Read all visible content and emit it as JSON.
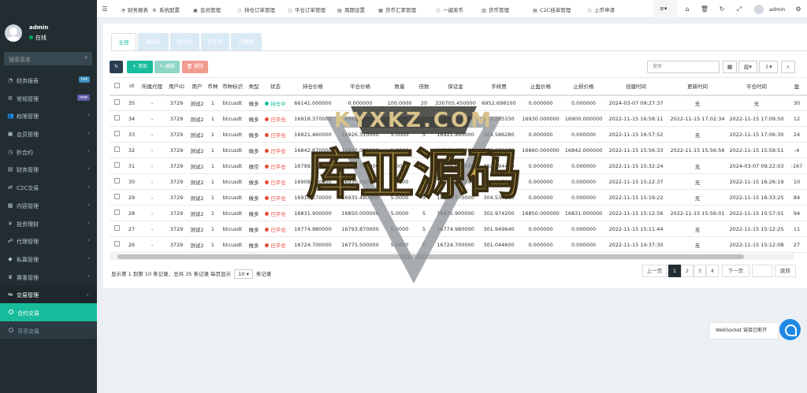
{
  "user": {
    "name": "admin",
    "status": "在线"
  },
  "sidebar": {
    "search_placeholder": "搜索菜单",
    "items": [
      {
        "label": "财务报表",
        "icon": "gauge-icon",
        "badge": "hot",
        "badge_color": "#3c8dbc"
      },
      {
        "label": "常规管理",
        "icon": "gear-icon",
        "badge": "new",
        "badge_color": "#605ca8"
      },
      {
        "label": "权限管理",
        "icon": "group-icon"
      },
      {
        "label": "会员管理",
        "icon": "user-icon"
      },
      {
        "label": "秒合约",
        "icon": "clock-icon"
      },
      {
        "label": "财务管理",
        "icon": "book-icon"
      },
      {
        "label": "C2C交易",
        "icon": "exchange-icon"
      },
      {
        "label": "内容管理",
        "icon": "file-icon"
      },
      {
        "label": "投资理财",
        "icon": "money-icon"
      },
      {
        "label": "代理管理",
        "icon": "agent-icon"
      },
      {
        "label": "私募管理",
        "icon": "diamond-icon"
      },
      {
        "label": "赛事管理",
        "icon": "trophy-icon"
      },
      {
        "label": "交易管理",
        "icon": "trade-icon"
      }
    ],
    "subitems": [
      {
        "label": "合约交易",
        "active": true
      },
      {
        "label": "币币交易",
        "active": false
      }
    ]
  },
  "topnav": {
    "items": [
      {
        "label": "财务报表"
      },
      {
        "label": "系统配置"
      },
      {
        "label": "会员管理"
      },
      {
        "label": "持仓订单管理"
      },
      {
        "label": "平仓订单管理"
      },
      {
        "label": "周期设置"
      },
      {
        "label": "货币汇率管理"
      },
      {
        "label": "一键发币"
      },
      {
        "label": "货币管理"
      },
      {
        "label": "C2C挂单管理"
      },
      {
        "label": "上币申请"
      }
    ],
    "user": "admin"
  },
  "tabs": [
    "全部",
    "待持仓",
    "持仓中",
    "已平仓",
    "已撤销"
  ],
  "toolbar": {
    "add": "添加",
    "edit": "编辑",
    "delete": "删除",
    "search_placeholder": "搜索"
  },
  "table": {
    "headers": [
      "id",
      "所属代理",
      "用户ID",
      "用户",
      "币种",
      "币种标识",
      "类型",
      "状态",
      "持仓价格",
      "平仓价格",
      "数量",
      "倍数",
      "保证金",
      "手续费",
      "止盈价格",
      "止损价格",
      "创建时间",
      "更新时间",
      "平仓时间"
    ],
    "rows": [
      [
        "35",
        "-",
        "3729",
        "测试2",
        "1",
        "btcusdt",
        "做多",
        "持仓中",
        "66141.000000",
        "0.000000",
        "100.0000",
        "20",
        "330705.450000",
        "6952.698100",
        "0.000000",
        "0.000000",
        "2024-03-07 09:27:37",
        "无",
        "无",
        "30"
      ],
      [
        "34",
        "-",
        "3729",
        "测试2",
        "1",
        "btcusdt",
        "做多",
        "已平仓",
        "16918.370000",
        "16943.470000",
        "5.0000",
        "5",
        "16918.370000",
        "152.265330",
        "16930.000000",
        "16900.000000",
        "2022-11-15 16:58:11",
        "2022-11-15 17:02:34",
        "2022-11-15 17:09:50",
        "12"
      ],
      [
        "33",
        "-",
        "3729",
        "测试2",
        "1",
        "btcusdt",
        "做多",
        "已平仓",
        "16921.460000",
        "16926.310000",
        "5.0000",
        "5",
        "16921.460000",
        "304.586280",
        "0.000000",
        "0.000000",
        "2022-11-15 16:57:52",
        "无",
        "2022-11-15 17:06:30",
        "24"
      ],
      [
        "32",
        "-",
        "3729",
        "测试2",
        "1",
        "btcusdt",
        "做多",
        "已平仓",
        "16842.870000",
        "16842.000000",
        "5.0000",
        "5",
        "16842.870000",
        "303.171660",
        "16860.000000",
        "16842.000000",
        "2022-11-15 15:56:33",
        "2022-11-15 15:56:56",
        "2022-11-15 15:58:51",
        "-4"
      ],
      [
        "31",
        "-",
        "3729",
        "测试2",
        "1",
        "btcusdt",
        "做空",
        "已平仓",
        "16799.690000",
        "66068.760000",
        "5.0000",
        "5",
        "16799.690000",
        "302.394420",
        "0.000000",
        "0.000000",
        "2022-11-15 15:32:24",
        "无",
        "2024-03-07 09:22:03",
        "-167"
      ],
      [
        "30",
        "-",
        "3729",
        "测试2",
        "1",
        "btcusdt",
        "做多",
        "已平仓",
        "16908.200000",
        "16930.000000",
        "5.0000",
        "5",
        "16908.200000",
        "304.347600",
        "0.000000",
        "0.000000",
        "2022-11-15 15:22:37",
        "无",
        "2022-11-15 16:26:19",
        "10"
      ],
      [
        "29",
        "-",
        "3729",
        "测试2",
        "1",
        "btcusdt",
        "做多",
        "已平仓",
        "16918.570000",
        "16935.480000",
        "5.0000",
        "5",
        "16918.570000",
        "304.534260",
        "0.000000",
        "0.000000",
        "2022-11-15 15:19:22",
        "无",
        "2022-11-15 16:33:25",
        "84"
      ],
      [
        "28",
        "-",
        "3729",
        "测试2",
        "1",
        "btcusdt",
        "做多",
        "已平仓",
        "16831.900000",
        "16850.000000",
        "5.0000",
        "5",
        "16831.900000",
        "302.974200",
        "16850.000000",
        "16831.000000",
        "2022-11-15 15:12:56",
        "2022-11-15 15:56:01",
        "2022-11-15 15:57:01",
        "94"
      ],
      [
        "27",
        "-",
        "3729",
        "测试2",
        "1",
        "btcusdt",
        "做多",
        "已平仓",
        "16774.980000",
        "16793.870000",
        "5.0000",
        "5",
        "16774.980000",
        "301.949640",
        "0.000000",
        "0.000000",
        "2022-11-15 15:11:44",
        "无",
        "2022-11-15 15:12:25",
        "11"
      ],
      [
        "26",
        "-",
        "3729",
        "测试2",
        "1",
        "btcusdt",
        "做多",
        "已平仓",
        "16724.700000",
        "16775.500000",
        "5.0000",
        "5",
        "16724.700000",
        "301.044600",
        "0.000000",
        "0.000000",
        "2022-11-15 14:37:30",
        "无",
        "2022-11-15 15:12:08",
        "27"
      ]
    ]
  },
  "footer": {
    "pre": "显示第 1 到第 10 条记录，总共 35 条记录 每页显示",
    "page_size": "10",
    "post": "条记录"
  },
  "pagination": {
    "prev": "上一页",
    "pages": [
      "1",
      "2",
      "3",
      "4"
    ],
    "next": "下一页",
    "jump": "跳转"
  },
  "websocket": {
    "status": "WebSocket 链接已断开"
  },
  "watermark": {
    "top": "KYXKZ.COM",
    "main": "库亚源码"
  },
  "colors": {
    "accent": "#18bc9c",
    "sidebar": "#222d32",
    "blue_btn": "#2c3e50",
    "edit": "#8fd7c6",
    "delete": "#f29b8f",
    "danger": "#e74c3c"
  }
}
